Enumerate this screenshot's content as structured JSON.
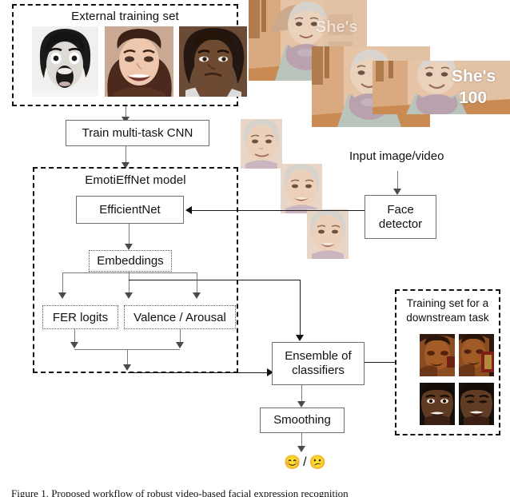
{
  "figure": {
    "caption": "Figure 1.  Proposed workflow of robust video-based facial expression recognition"
  },
  "groups": {
    "external_training_set": {
      "title": "External training set"
    },
    "emotieffnet_model": {
      "title": "EmotiEffNet model"
    },
    "downstream_training_set": {
      "title": "Training set for a\ndownstream task",
      "line1": "Training set for a",
      "line2": "downstream task"
    }
  },
  "boxes": {
    "train_cnn": {
      "label": "Train multi-task CNN"
    },
    "efficientnet": {
      "label": "EfficientNet"
    },
    "embeddings": {
      "label": "Embeddings"
    },
    "fer_logits": {
      "label": "FER logits"
    },
    "valence_arousal": {
      "label": "Valence / Arousal"
    },
    "ensemble": {
      "label": "Ensemble of\nclassifiers",
      "line1": "Ensemble of",
      "line2": "classifiers"
    },
    "smoothing": {
      "label": "Smoothing"
    },
    "face_detector": {
      "label": "Face\ndetector",
      "line1": "Face",
      "line2": "detector"
    }
  },
  "labels": {
    "input_image_video": "Input image/video"
  },
  "output": {
    "positive_emoji": "😊",
    "separator": "/",
    "negative_emoji": "😕"
  },
  "media": {
    "external_faces": [
      {
        "name": "screaming-woman-bw",
        "caption": ""
      },
      {
        "name": "smiling-woman-color",
        "caption": ""
      },
      {
        "name": "serious-woman-color",
        "caption": ""
      }
    ],
    "input_frames": [
      {
        "name": "elderly-woman-frame-1",
        "overlay": "She's"
      },
      {
        "name": "elderly-woman-frame-2",
        "overlay": "She's"
      },
      {
        "name": "elderly-woman-frame-3",
        "overlay_line1": "She's",
        "overlay_line2": "100"
      }
    ],
    "cropped_faces": [
      {
        "name": "cropped-face-1"
      },
      {
        "name": "cropped-face-2"
      },
      {
        "name": "cropped-face-3"
      }
    ],
    "downstream_faces": [
      {
        "name": "downstream-face-dark-1"
      },
      {
        "name": "downstream-face-dark-2"
      },
      {
        "name": "downstream-face-bright-1"
      },
      {
        "name": "downstream-face-bright-2"
      }
    ]
  },
  "colors": {
    "box_border": "#6f6f6f",
    "dashed_border": "#101010",
    "connector": "#7a7a7a",
    "text": "#111111",
    "background": "#ffffff"
  }
}
